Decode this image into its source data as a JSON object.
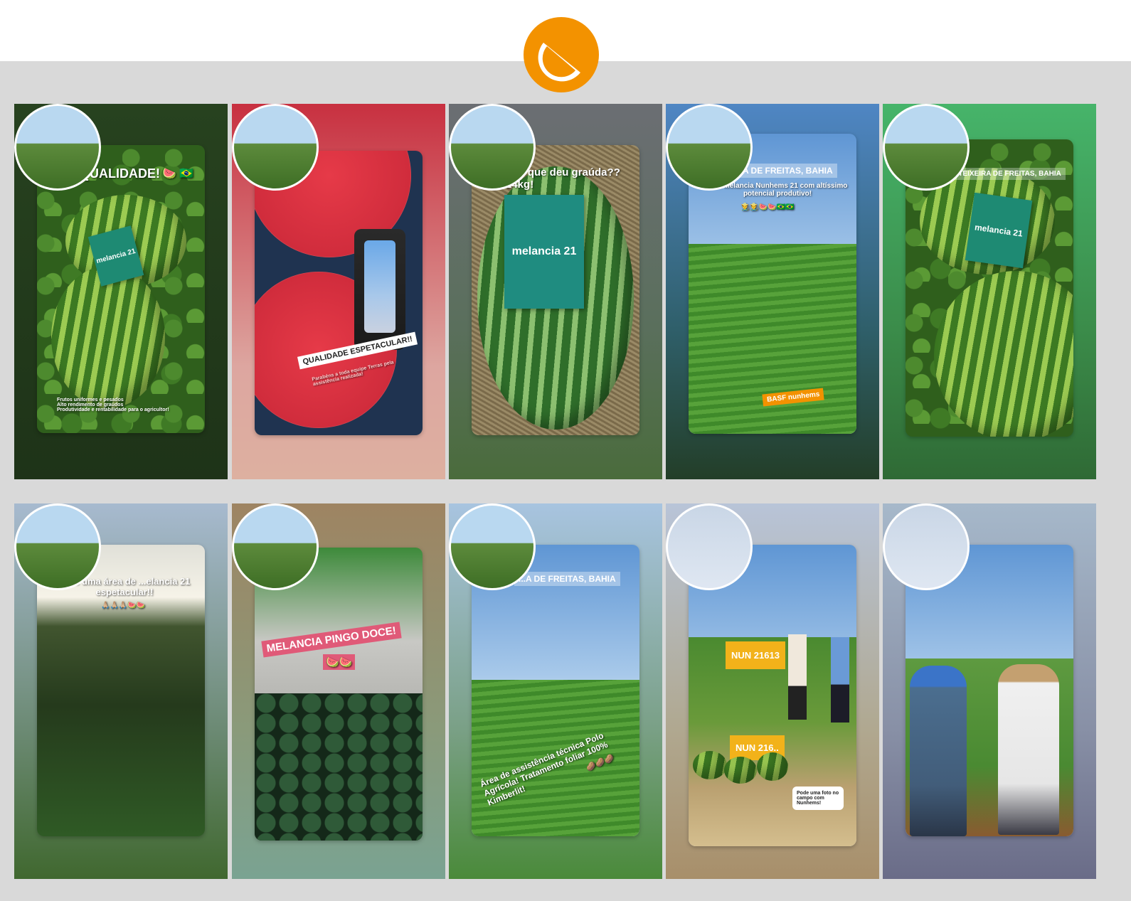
{
  "brand": {
    "logo_icon": "watermelon-slice-icon",
    "accent": "#f39200"
  },
  "colors": {
    "white": "#ffffff",
    "green": "#1e8a73",
    "pink": "#e05a78",
    "orange": "#f39200",
    "yellow": "#f2b21a"
  },
  "stories": [
    {
      "id": 1,
      "avatar": "farmer-a",
      "headline": "QUALIDADE!",
      "emoji": "🍉 🇧🇷",
      "pack_label": "melancia 21",
      "checklist": [
        "Frutos uniformes e pesados",
        "Alto rendimento de graúdos",
        "Produtividade e rentabilidade para o agricultor!"
      ]
    },
    {
      "id": 2,
      "avatar": "farmer-a",
      "banner": "QUALIDADE ESPETACULAR!!",
      "subtext": "Parabéns a toda equipe Terras pela assistência realizada!"
    },
    {
      "id": 3,
      "avatar": "farmer-a",
      "headline": "...rá que deu graúda?? 24kg!",
      "pack_label": "melancia 21"
    },
    {
      "id": 4,
      "avatar": "farmer-a",
      "tag": "...A DE FREITAS, BAHIA",
      "headline": "...de Melancia Nunhems 21 com altíssimo potencial produtivo!",
      "emoji": "👨‍🌾👨‍🌾🍉🍉🇧🇷🇧🇷",
      "badge": "BASF  nunhems"
    },
    {
      "id": 5,
      "avatar": "farmer-a",
      "tag": "...TEIXEIRA DE FREITAS, BAHIA",
      "pack_label": "melancia 21"
    },
    {
      "id": 6,
      "avatar": "farmer-a",
      "headline": "...ais uma área de ...elancia 21 espetacular!!",
      "emoji": "🙏🏼🙏🏼🙏🏼🍉🍉"
    },
    {
      "id": 7,
      "avatar": "farmer-a",
      "banner": "MELANCIA PINGO DOCE!",
      "emoji": "🍉🍉"
    },
    {
      "id": 8,
      "avatar": "farmer-a",
      "tag": "...A DE FREITAS, BAHIA",
      "headline": "Área de assistência técnica Polo Agrícola! Tratamento foliar 100% Kimberlit!",
      "emoji": "🥔🥔🥔"
    },
    {
      "id": 9,
      "avatar": "farmer-b",
      "sign_top": "NUN 21613",
      "sign_bottom": "NUN 216..",
      "note": "Pode uma foto no campo com Nunhems!"
    },
    {
      "id": 10,
      "avatar": "farmer-b"
    }
  ]
}
